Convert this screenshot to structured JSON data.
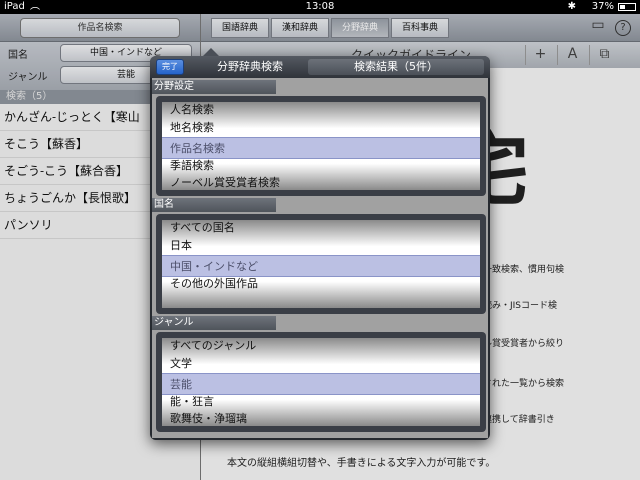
{
  "status_bar": {
    "device": "iPad",
    "wifi": "wifi-icon",
    "time": "13:08",
    "battery": "37%",
    "bluetooth": "bluetooth-icon"
  },
  "left": {
    "search_label": "作品名検索",
    "filters": [
      {
        "label": "国名",
        "value": "中国・インドなど"
      },
      {
        "label": "ジャンル",
        "value": "芸能"
      }
    ],
    "result_header": "検索（5）",
    "results": [
      "かんざん-じっとく【寒山",
      "そこう【蘇香】",
      "そごう-こう【蘇合香】",
      "ちょうごんか【長恨歌】",
      "パンソリ"
    ]
  },
  "right": {
    "tabs": [
      "国語辞典",
      "漢和辞典",
      "分野辞典",
      "百科事典"
    ],
    "active_tab": 2,
    "doc_title": "クイックガイドライン",
    "toolbar_buttons": [
      "+",
      "A",
      "⧉"
    ],
    "doc_lines": [
      "一致検索、慣用句検",
      "読み・JISコード検",
      "ル賞受賞者から絞り",
      "された一覧から検索",
      "連携して辞書引き"
    ],
    "doc_footer": "本文の縦組横組切替や、手書きによる文字入力が可能です。"
  },
  "popover": {
    "done_label": "完了",
    "segment_1": "分野辞典検索",
    "segment_2": "検索結果（5件）",
    "sections": [
      {
        "label": "分野設定",
        "rows": [
          "人名検索",
          "地名検索",
          "作品名検索",
          "季語検索",
          "ノーベル賞受賞者検索"
        ],
        "selected": 2
      },
      {
        "label": "国名",
        "rows": [
          "すべての国名",
          "日本",
          "中国・インドなど",
          "その他の外国作品"
        ],
        "selected": 2
      },
      {
        "label": "ジャンル",
        "rows": [
          "すべてのジャンル",
          "文学",
          "芸能",
          "能・狂言",
          "歌舞伎・浄瑠璃"
        ],
        "selected": 2
      }
    ]
  }
}
